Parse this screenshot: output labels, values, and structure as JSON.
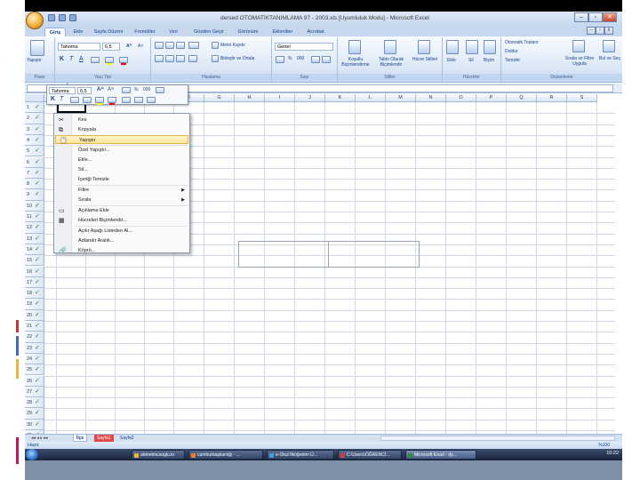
{
  "window": {
    "title": "dersed OTOMATİKTANIMLAMA 97 - 2003.xls [Uyumluluk Modu] - Microsoft Excel",
    "minimize": "–",
    "restore": "▫",
    "close": "✕"
  },
  "doc_controls": {
    "minimize": "–",
    "restore": "▫",
    "close": "x"
  },
  "tabs": [
    "Giriş",
    "Ekle",
    "Sayfa Düzeni",
    "Formüller",
    "Veri",
    "Gözden Geçir",
    "Görünüm",
    "Eklentiler",
    "Acrobat"
  ],
  "ribbon": {
    "clipboard": {
      "paste": "Yapıştır",
      "label": "Pano"
    },
    "font": {
      "name": "Tahoma",
      "size": "6,5",
      "bold": "K",
      "italic": "T",
      "underline": "A",
      "grow": "A^",
      "shrink": "A˅",
      "label": "Yazı Tipi"
    },
    "alignment": {
      "merge": "Birleştir ve Ortala",
      "wrap": "Metni Kaydır",
      "label": "Hizalama"
    },
    "number": {
      "format": "Genel",
      "percent": "%",
      "comma": "000",
      "label": "Sayı"
    },
    "styles": {
      "conditional": "Koşullu Biçimlendirme",
      "table": "Tablo Olarak Biçimlendir",
      "cell": "Hücre Stilleri",
      "label": "Stiller"
    },
    "cells": {
      "insert": "Ekle",
      "delete": "Sil",
      "format": "Biçim",
      "label": "Hücreler"
    },
    "editing": {
      "autosum": "Otomatik Toplam",
      "fill": "Doldur",
      "clear": "Temizle",
      "sort": "Sırala ve Filtre Uygula",
      "find": "Bul ve Seç",
      "label": "Düzenleme"
    }
  },
  "formula_bar": {
    "fx": "fx"
  },
  "columns": [
    "A",
    "B",
    "C",
    "D",
    "E",
    "F",
    "G",
    "H",
    "I",
    "J",
    "K",
    "L",
    "M",
    "N",
    "O",
    "P",
    "Q",
    "R",
    "S"
  ],
  "rows": [
    "1",
    "2",
    "3",
    "4",
    "5",
    "6",
    "7",
    "8",
    "9",
    "10",
    "11",
    "12",
    "13",
    "14",
    "15",
    "16",
    "17",
    "18",
    "19",
    "20",
    "21",
    "22",
    "23",
    "24",
    "25",
    "26",
    "27",
    "28",
    "29",
    "30",
    "31"
  ],
  "mini_toolbar": {
    "font": "Tahoma",
    "size": "6,5",
    "bold": "K",
    "italic": "T"
  },
  "context_menu": {
    "items": [
      {
        "label": "Kes",
        "icon": "✂"
      },
      {
        "label": "Kopyala",
        "icon": "⧉"
      },
      {
        "label": "Yapıştır",
        "icon": "📋",
        "highlighted": true
      },
      {
        "label": "Özel Yapıştır...",
        "icon": ""
      },
      {
        "label": "Ekle...",
        "icon": ""
      },
      {
        "label": "Sil...",
        "icon": ""
      },
      {
        "label": "İçeriği Temizle",
        "icon": ""
      },
      {
        "label": "Filtre",
        "icon": "",
        "submenu": true
      },
      {
        "label": "Sırala",
        "icon": "",
        "submenu": true
      },
      {
        "label": "Açıklama Ekle",
        "icon": "▭"
      },
      {
        "label": "Hücreleri Biçimlendir...",
        "icon": "▦"
      },
      {
        "label": "Açılır Aşağı Listeden Al...",
        "icon": ""
      },
      {
        "label": "Adlandır Aralık...",
        "icon": ""
      },
      {
        "label": "Köprü...",
        "icon": "🔗"
      }
    ],
    "submenu_arrow": "▶"
  },
  "sheets": [
    "İlçe",
    "Sayfa1",
    "Sayfa2"
  ],
  "status": {
    "mode": "Hazır",
    "zoom": "%100"
  },
  "taskbar": {
    "items": [
      "ahmetmcaoglu.io",
      "cumhurbaşkanlığı - ...",
      "e-Okul İlköğretim Ü...",
      "C:\\Users\\ÖĞRENCİ...",
      "Microsoft Excel - dy..."
    ],
    "clock": "10:22"
  },
  "colors": {
    "ribbon": "#dbe7f6",
    "accent": "#15428b",
    "highlight": "#fde49a"
  }
}
